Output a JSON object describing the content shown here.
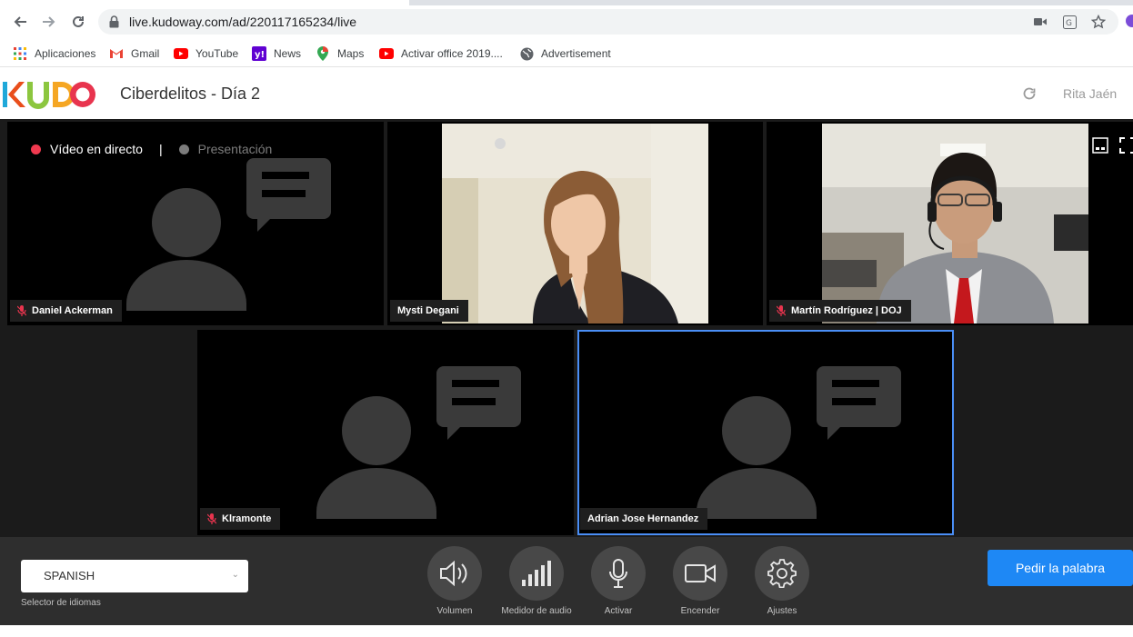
{
  "browser": {
    "url": "live.kudoway.com/ad/220117165234/live",
    "bookmarks": [
      {
        "label": "Aplicaciones",
        "icon": "apps-grid-icon"
      },
      {
        "label": "Gmail",
        "icon": "gmail-icon"
      },
      {
        "label": "YouTube",
        "icon": "youtube-icon"
      },
      {
        "label": "News",
        "icon": "yahoo-icon"
      },
      {
        "label": "Maps",
        "icon": "maps-pin-icon"
      },
      {
        "label": "Activar office 2019....",
        "icon": "youtube-icon"
      },
      {
        "label": "Advertisement",
        "icon": "globe-icon"
      }
    ]
  },
  "header": {
    "logo": "KUDO",
    "event_title": "Ciberdelitos - Día 2",
    "user_name": "Rita Jaén"
  },
  "stage": {
    "live_label": "Vídeo en directo",
    "separator": "|",
    "presentation_label": "Presentación",
    "participants": [
      {
        "name": "Daniel Ackerman",
        "muted": true,
        "video": false
      },
      {
        "name": "Mysti Degani",
        "muted": false,
        "video": true
      },
      {
        "name": "Martín Rodríguez | DOJ",
        "muted": true,
        "video": true
      },
      {
        "name": "Klramonte",
        "muted": true,
        "video": false
      },
      {
        "name": "Adrian Jose Hernandez",
        "muted": false,
        "video": false,
        "active_speaker": true
      }
    ]
  },
  "controls": {
    "language_value": "SPANISH",
    "language_caption": "Selector de idiomas",
    "buttons": [
      {
        "label": "Volumen",
        "icon": "speaker-icon"
      },
      {
        "label": "Medidor de audio",
        "icon": "audio-meter-icon"
      },
      {
        "label": "Activar",
        "icon": "microphone-icon"
      },
      {
        "label": "Encender",
        "icon": "camera-icon"
      },
      {
        "label": "Ajustes",
        "icon": "gear-icon"
      }
    ],
    "request_button": "Pedir la palabra"
  },
  "colors": {
    "accent_blue": "#1e88f5",
    "live_red": "#f0394f",
    "active_border": "#4a8ef6",
    "placeholder_gray": "#3a3a3a"
  }
}
